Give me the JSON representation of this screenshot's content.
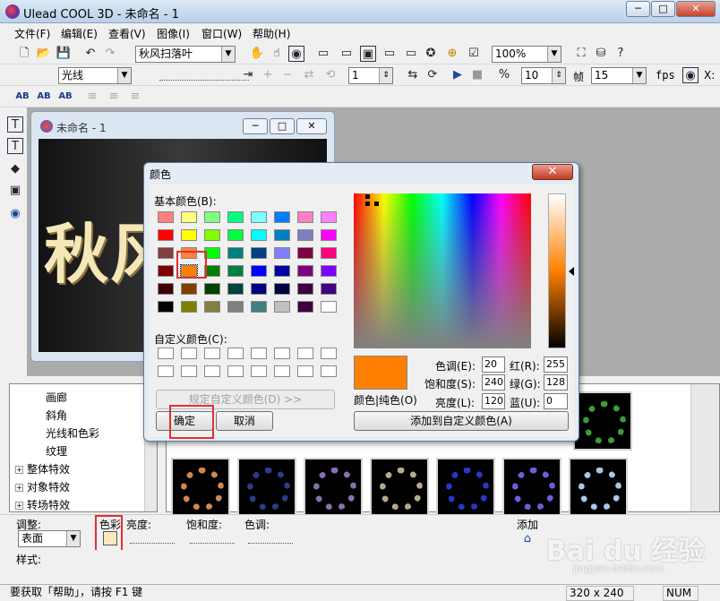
{
  "window": {
    "title": "Ulead COOL 3D - 未命名 - 1",
    "min": "─",
    "max": "□",
    "close": "✕"
  },
  "menu": [
    "文件(F)",
    "编辑(E)",
    "查看(V)",
    "图像(I)",
    "窗口(W)",
    "帮助(H)"
  ],
  "toolbar1": {
    "effect_select": "秋风扫落叶",
    "zoom": "100%"
  },
  "toolbar2": {
    "light_select": "光线",
    "frame_input": "1",
    "fps_input": "10",
    "frames_label": "帧",
    "fps_value": "15",
    "fps_label": "fps",
    "x_label": "X:"
  },
  "toolbar3": {
    "btn1": "AB",
    "btn2": "AB",
    "btn3": "AB"
  },
  "document": {
    "title": "未命名 - 1",
    "canvas_text": "秋风"
  },
  "tree": {
    "items": [
      {
        "label": "画廊",
        "expander": ""
      },
      {
        "label": "斜角",
        "expander": ""
      },
      {
        "label": "光线和色彩",
        "expander": ""
      },
      {
        "label": "纹理",
        "expander": ""
      },
      {
        "label": "整体特效",
        "expander": "+"
      },
      {
        "label": "对象特效",
        "expander": "+"
      },
      {
        "label": "转场特效",
        "expander": "+"
      }
    ]
  },
  "thumbnails": {
    "colors": [
      "#3c9c3c",
      "#d08850",
      "#2a3c8a",
      "#8a6fb0",
      "#b8aa88",
      "#2838c8",
      "#7858d8",
      "#a8c8e8"
    ]
  },
  "adjust": {
    "label": "调整:",
    "select": "表面",
    "color_label": "色彩",
    "brightness_label": "亮度:",
    "saturation_label": "饱和度:",
    "hue_label": "色调:",
    "add_label": "添加"
  },
  "style_label": "样式:",
  "status": {
    "help": "要获取「帮助」，请按 F1 键",
    "size": "320 x 240",
    "num": "NUM"
  },
  "dialog": {
    "title": "颜色",
    "close": "✕",
    "basic_label": "基本颜色(B):",
    "custom_label": "自定义颜色(C):",
    "define_custom": "规定自定义颜色(D) >>",
    "ok": "确定",
    "cancel": "取消",
    "add_custom": "添加到自定义颜色(A)",
    "solid_label": "颜色|纯色(O)",
    "hue_label": "色调(E):",
    "hue_value": "20",
    "sat_label": "饱和度(S):",
    "sat_value": "240",
    "lum_label": "亮度(L):",
    "lum_value": "120",
    "red_label": "红(R):",
    "red_value": "255",
    "green_label": "绿(G):",
    "green_value": "128",
    "blue_label": "蓝(U):",
    "blue_value": "0",
    "basic_colors": [
      "#ff8080",
      "#ffff80",
      "#80ff80",
      "#00ff80",
      "#80ffff",
      "#0080ff",
      "#ff80c0",
      "#ff80ff",
      "#ff0000",
      "#ffff00",
      "#80ff00",
      "#00ff40",
      "#00ffff",
      "#0080c0",
      "#8080c0",
      "#ff00ff",
      "#804040",
      "#ff8040",
      "#00ff00",
      "#008080",
      "#004080",
      "#8080ff",
      "#800040",
      "#ff0080",
      "#800000",
      "#ff8000",
      "#008000",
      "#008040",
      "#0000ff",
      "#0000a0",
      "#800080",
      "#8000ff",
      "#400000",
      "#804000",
      "#004000",
      "#004040",
      "#000080",
      "#000040",
      "#400040",
      "#400080",
      "#000000",
      "#808000",
      "#808040",
      "#808080",
      "#408080",
      "#c0c0c0",
      "#400040",
      "#ffffff"
    ],
    "selected_color": "#ff8000"
  },
  "watermark": {
    "brand": "Bai du 经验",
    "url": "jingyan.baidu.com"
  }
}
